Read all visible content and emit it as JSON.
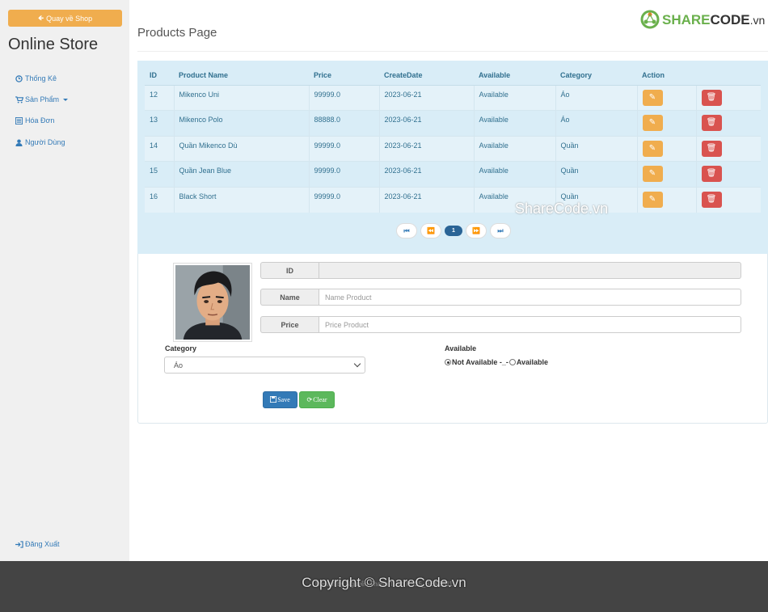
{
  "sidebar": {
    "back_button": "Quay về Shop",
    "brand": "Online Store",
    "items": [
      {
        "label": "Thống Kê",
        "icon": "clock-icon"
      },
      {
        "label": "Sản Phẩm",
        "icon": "cart-icon"
      },
      {
        "label": "Hóa Đơn",
        "icon": "list-icon"
      },
      {
        "label": "Người Dùng",
        "icon": "user-icon"
      }
    ],
    "logout": "Đăng Xuất"
  },
  "header": {
    "page_title": "Products Page",
    "logo_share": "SHARE",
    "logo_code": "CODE",
    "logo_vn": ".vn"
  },
  "table": {
    "headers": [
      "ID",
      "Product Name",
      "Price",
      "CreateDate",
      "Available",
      "Category",
      "Action"
    ],
    "rows": [
      {
        "id": "12",
        "name": "Mikenco Uni",
        "price": "99999.0",
        "date": "2023-06-21",
        "available": "Available",
        "category": "Áo"
      },
      {
        "id": "13",
        "name": "Mikenco Polo",
        "price": "88888.0",
        "date": "2023-06-21",
        "available": "Available",
        "category": "Áo"
      },
      {
        "id": "14",
        "name": "Quần Mikenco Dù",
        "price": "99999.0",
        "date": "2023-06-21",
        "available": "Available",
        "category": "Quần"
      },
      {
        "id": "15",
        "name": "Quần Jean Blue",
        "price": "99999.0",
        "date": "2023-06-21",
        "available": "Available",
        "category": "Quần"
      },
      {
        "id": "16",
        "name": "Black Short",
        "price": "99999.0",
        "date": "2023-06-21",
        "available": "Available",
        "category": "Quần"
      }
    ]
  },
  "pager": {
    "current_page": "1"
  },
  "watermark_mid": "ShareCode.vn",
  "form": {
    "id_label": "ID",
    "id_value": "",
    "name_label": "Name",
    "name_placeholder": "Name Product",
    "price_label": "Price",
    "price_placeholder": "Price Product",
    "category_label": "Category",
    "category_selected": "Áo",
    "available_label": "Available",
    "radio_not_available": "Not Available -_-",
    "radio_available": "Available",
    "save_label": "Save",
    "clear_label": "Clear"
  },
  "footer": {
    "copyright": "Copyright © ShareCode.vn",
    "under_text": "Design by Nguyễn Thanh Tuấn PS25_SOF3011"
  },
  "colors": {
    "primary": "#337ab7",
    "warning": "#f0ad4e",
    "danger": "#d9534f",
    "success": "#5cb85c",
    "info_bg": "#d9edf7"
  }
}
